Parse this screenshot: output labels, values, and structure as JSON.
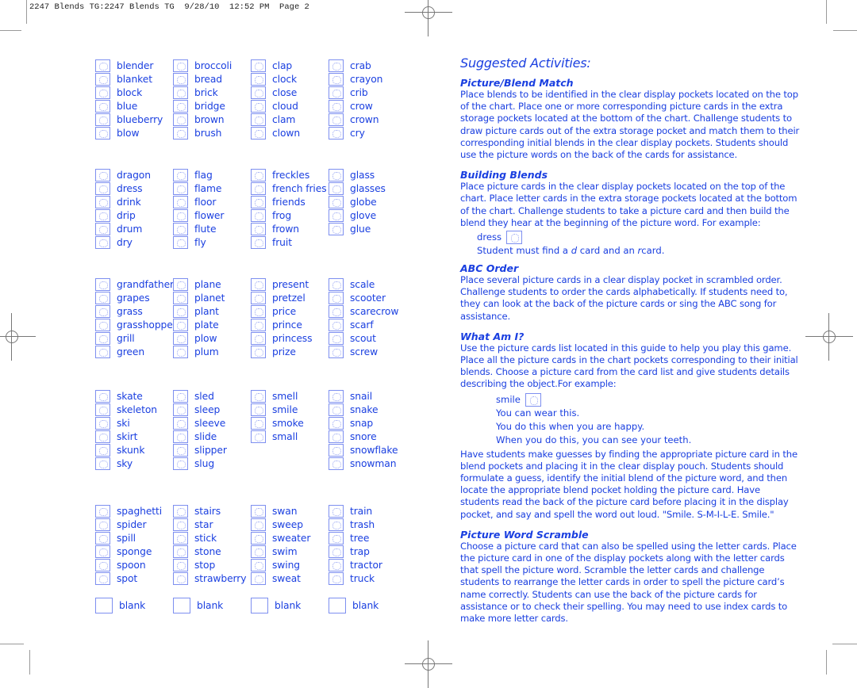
{
  "slug_line": "2247 Blends TG:2247 Blends TG  9/28/10  12:52 PM  Page 2",
  "word_groups": [
    {
      "columns": [
        [
          "blender",
          "blanket",
          "block",
          "blue",
          "blueberry",
          "blow"
        ],
        [
          "broccoli",
          "bread",
          "brick",
          "bridge",
          "brown",
          "brush"
        ],
        [
          "clap",
          "clock",
          "close",
          "cloud",
          "clam",
          "clown"
        ],
        [
          "crab",
          "crayon",
          "crib",
          "crow",
          "crown",
          "cry"
        ]
      ]
    },
    {
      "columns": [
        [
          "dragon",
          "dress",
          "drink",
          "drip",
          "drum",
          "dry"
        ],
        [
          "flag",
          "flame",
          "floor",
          "flower",
          "flute",
          "fly"
        ],
        [
          "freckles",
          "french fries",
          "friends",
          "frog",
          "frown",
          "fruit"
        ],
        [
          "glass",
          "glasses",
          "globe",
          "glove",
          "glue"
        ]
      ]
    },
    {
      "columns": [
        [
          "grandfather",
          "grapes",
          "grass",
          "grasshopper",
          "grill",
          "green"
        ],
        [
          "plane",
          "planet",
          "plant",
          "plate",
          "plow",
          "plum"
        ],
        [
          "present",
          "pretzel",
          "price",
          "prince",
          "princess",
          "prize"
        ],
        [
          "scale",
          "scooter",
          "scarecrow",
          "scarf",
          "scout",
          "screw"
        ]
      ]
    },
    {
      "columns": [
        [
          "skate",
          "skeleton",
          "ski",
          "skirt",
          "skunk",
          "sky"
        ],
        [
          "sled",
          "sleep",
          "sleeve",
          "slide",
          "slipper",
          "slug"
        ],
        [
          "smell",
          "smile",
          "smoke",
          "small"
        ],
        [
          "snail",
          "snake",
          "snap",
          "snore",
          "snowflake",
          "snowman"
        ]
      ]
    },
    {
      "columns": [
        [
          "spaghetti",
          "spider",
          "spill",
          "sponge",
          "spoon",
          "spot"
        ],
        [
          "stairs",
          "star",
          "stick",
          "stone",
          "stop",
          "strawberry"
        ],
        [
          "swan",
          "sweep",
          "sweater",
          "swim",
          "swing",
          "sweat"
        ],
        [
          "train",
          "trash",
          "tree",
          "trap",
          "tractor",
          "truck"
        ]
      ]
    }
  ],
  "blank_cards": [
    "blank",
    "blank",
    "blank",
    "blank"
  ],
  "activities": {
    "title": "Suggested Activities:",
    "picture_blend_match": {
      "heading": "Picture/Blend Match",
      "body": "Place blends to be identified in the clear display pockets located on the top of the chart. Place one or more corresponding picture cards in the extra storage pockets located at the bottom of the chart. Challenge students to draw picture cards out of the extra storage pocket and match them to their corresponding initial blends in the clear display pockets. Students should use the picture words on the back of the cards for assistance."
    },
    "building_blends": {
      "heading": "Building Blends",
      "body": "Place picture cards in the clear display pockets located on the top of the chart. Place letter cards in the extra storage pockets located at the bottom of the chart. Challenge students to take a picture card and then build the blend they hear at the beginning of the picture word. For example:",
      "example_word": "dress",
      "example_pre": "Student must find a ",
      "example_d": "d",
      "example_mid": " card and an ",
      "example_r": "r",
      "example_post": " card."
    },
    "abc_order": {
      "heading": "ABC Order",
      "body": "Place several picture cards in a clear display pocket in scrambled order. Challenge students to order the cards alphabetically. If students need to, they can look at the back of the picture cards or sing the ABC song for assistance."
    },
    "what_am_i": {
      "heading": "What Am I?",
      "body": "Use the picture cards list located in this guide to help you play this game. Place all the picture cards in the chart pockets corresponding to their initial blends. Choose a picture card from the card list and give students details describing the object.For example:",
      "example_word": "smile",
      "clues": [
        "You can wear this.",
        "You do this when you are happy.",
        "When you do this, you can see your teeth."
      ],
      "body2": "Have students make guesses by finding the appropriate picture card in the blend pockets and placing it in the clear display pouch. Students should formulate a guess, identify the initial blend of the picture word, and then locate the appropriate blend pocket holding the picture card. Have students read the back of the picture card before placing it in the display pocket, and say and spell the word out loud. \"Smile. S-M-I-L-E. Smile.\""
    },
    "picture_word_scramble": {
      "heading": "Picture Word Scramble",
      "body": "Choose a picture card that can also be spelled using the letter cards. Place the picture card in one of the display pockets along with the letter cards that spell the picture word. Scramble the letter cards and challenge students to rearrange the letter cards in order to spell the picture card’s name correctly. Students can use the back of the picture cards for assistance or to check their spelling. You may need to use index cards to make more letter cards."
    }
  }
}
